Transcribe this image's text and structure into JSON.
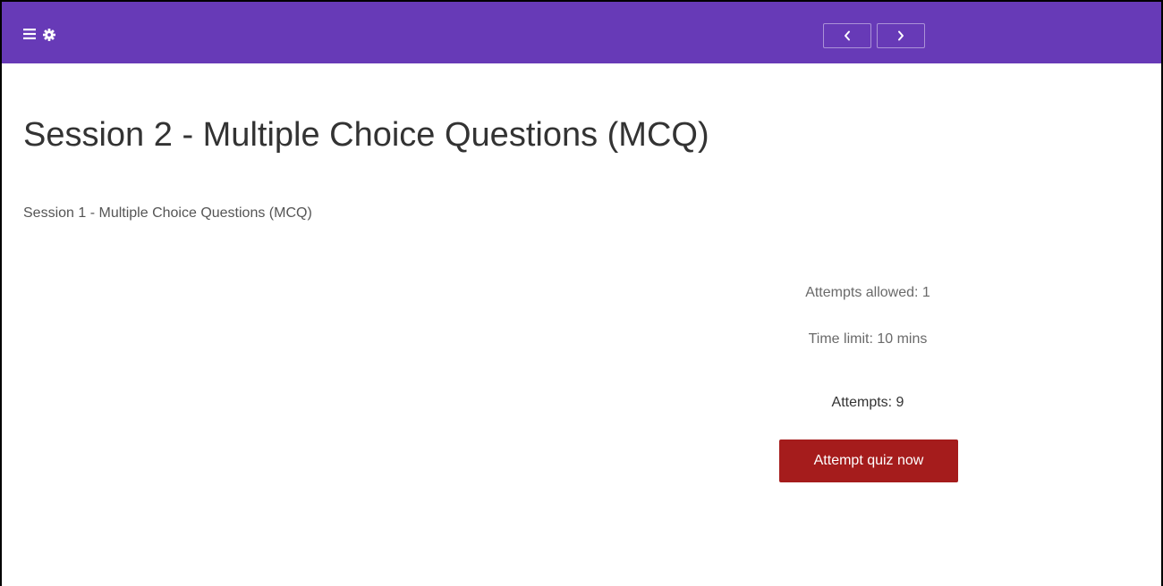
{
  "header": {
    "icons": {
      "menu": "hamburger-menu-icon",
      "settings": "gear-icon",
      "prev": "chevron-left-icon",
      "next": "chevron-right-icon"
    },
    "colors": {
      "bar": "#673ab7",
      "icon": "#ffffff"
    }
  },
  "main": {
    "title": "Session 2 - Multiple Choice Questions (MCQ)",
    "intro": "Session 1 - Multiple Choice Questions (MCQ)"
  },
  "quiz_info": {
    "attempts_allowed": "Attempts allowed: 1",
    "time_limit": "Time limit: 10 mins",
    "attempts": "Attempts: 9",
    "attempt_button_label": "Attempt quiz now",
    "button_color": "#a51c1c"
  }
}
